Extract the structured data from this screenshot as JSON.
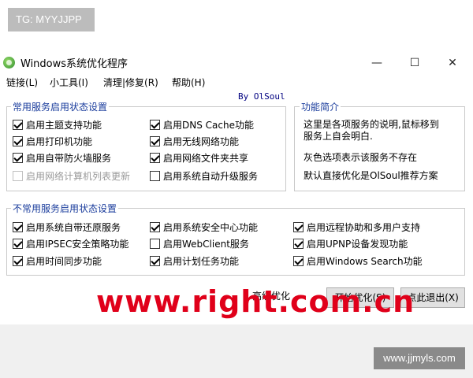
{
  "watermark_top": "TG: MYYJJPP",
  "window": {
    "title": "Windows系统优化程序",
    "minimize_glyph": "—",
    "maximize_glyph": "☐",
    "close_glyph": "✕"
  },
  "menu": [
    "链接(L)",
    "小工具(I)",
    "清理|修复(R)",
    "帮助(H)"
  ],
  "byline": "By OlSoul",
  "common_group": {
    "title": "常用服务启用状态设置",
    "items": [
      {
        "label": "启用主题支持功能",
        "checked": true,
        "enabled": true
      },
      {
        "label": "启用DNS Cache功能",
        "checked": true,
        "enabled": true
      },
      {
        "label": "启用打印机功能",
        "checked": true,
        "enabled": true
      },
      {
        "label": "启用无线网络功能",
        "checked": true,
        "enabled": true
      },
      {
        "label": "启用自带防火墙服务",
        "checked": true,
        "enabled": true
      },
      {
        "label": "启用网络文件夹共享",
        "checked": true,
        "enabled": true
      },
      {
        "label": "启用网络计算机列表更新",
        "checked": false,
        "enabled": false
      },
      {
        "label": "启用系统自动升级服务",
        "checked": false,
        "enabled": true
      }
    ]
  },
  "intro_group": {
    "title": "功能简介",
    "line1": "这里是各项服务的说明,鼠标移到",
    "line2": "服务上自会明白.",
    "line3": "灰色选项表示该服务不存在",
    "line4": "默认直接优化是OlSoul推荐方案"
  },
  "uncommon_group": {
    "title": "不常用服务启用状态设置",
    "items": [
      {
        "label": "启用系统自带还原服务",
        "checked": true,
        "enabled": true
      },
      {
        "label": "启用系统安全中心功能",
        "checked": true,
        "enabled": true
      },
      {
        "label": "启用远程协助和多用户支持",
        "checked": true,
        "enabled": true
      },
      {
        "label": "启用IPSEC安全策略功能",
        "checked": true,
        "enabled": true
      },
      {
        "label": "启用WebClient服务",
        "checked": false,
        "enabled": true
      },
      {
        "label": "启用UPNP设备发现功能",
        "checked": true,
        "enabled": true
      },
      {
        "label": "启用时间同步功能",
        "checked": true,
        "enabled": true
      },
      {
        "label": "启用计划任务功能",
        "checked": true,
        "enabled": true
      },
      {
        "label": "启用Windows Search功能",
        "checked": true,
        "enabled": true
      }
    ]
  },
  "bottom": {
    "advanced_fragment": "高级优化",
    "start_button": "开始优化(S)",
    "exit_button": "点此退出(X)"
  },
  "watermark_right": "www.right.com.cn",
  "watermark_site": "www.jjmyls.com",
  "colors": {
    "group_title": "#1a3c9c",
    "byline": "#000080",
    "watermark_red": "#e0001a"
  }
}
